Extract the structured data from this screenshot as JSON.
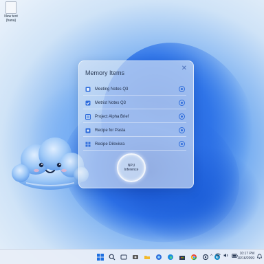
{
  "desktop": {
    "icon_label": "New text (hana)"
  },
  "panel": {
    "title": "Memory Items",
    "close_glyph": "✕",
    "items": [
      {
        "label": "Meeting Notes Q3",
        "icon": "note-icon",
        "selected": true
      },
      {
        "label": "Metrist Notes Q3",
        "icon": "checkbox-icon",
        "selected": true
      },
      {
        "label": "Project Alpha Brief",
        "icon": "document-icon",
        "selected": true
      },
      {
        "label": "Recipe for Pasta",
        "icon": "recipe-icon",
        "selected": true
      },
      {
        "label": "Recipe Dilovisra",
        "icon": "grid-icon",
        "selected": true
      }
    ],
    "npu": {
      "line1": "NPU",
      "line2": "Inference"
    }
  },
  "taskbar": {
    "apps": [
      "start-icon",
      "search-icon",
      "task-view-icon",
      "file-explorer-icon",
      "folder-icon",
      "copilot-icon",
      "edge-icon",
      "store-icon",
      "chrome-icon",
      "settings-icon",
      "explorer-icon"
    ],
    "tray": {
      "chevron": "^",
      "wifi": "wifi-icon",
      "volume": "volume-icon",
      "battery": "battery-icon"
    },
    "clock": {
      "time": "10:17 PM",
      "date": "10/16/2099"
    }
  },
  "colors": {
    "accent": "#2f6ddb",
    "panel": "#e4ecf6",
    "wallpaper": "#2a6de4"
  }
}
